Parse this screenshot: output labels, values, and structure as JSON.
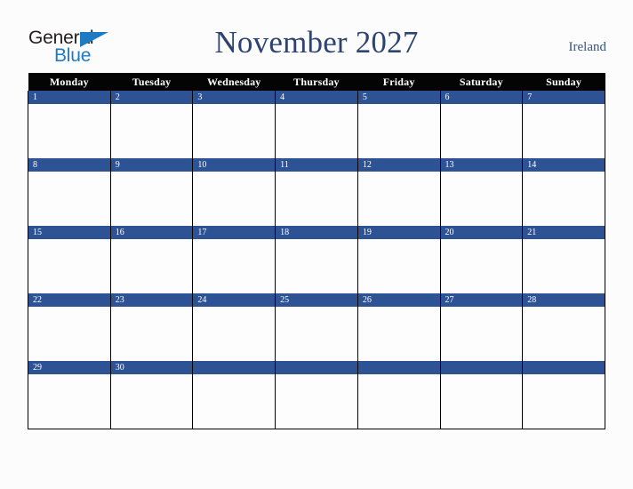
{
  "header": {
    "logo": {
      "word_one": "General",
      "word_two": "Blue",
      "triangle_icon": "blue-triangle-icon",
      "color_black": "#231f20",
      "color_blue": "#1f7ac4"
    },
    "title": "November 2027",
    "country": "Ireland",
    "title_color": "#2d4470"
  },
  "calendar": {
    "month": "November",
    "year": "2027",
    "weekday_headers": [
      "Monday",
      "Tuesday",
      "Wednesday",
      "Thursday",
      "Friday",
      "Saturday",
      "Sunday"
    ],
    "header_bg": "#040404",
    "header_fg": "#ffffff",
    "daynum_bg": "#2e5395",
    "daynum_fg": "#ffffff",
    "cell_bg": "#fdfdfd",
    "grid_line": "#000000",
    "weeks": [
      {
        "days": [
          "1",
          "2",
          "3",
          "4",
          "5",
          "6",
          "7"
        ]
      },
      {
        "days": [
          "8",
          "9",
          "10",
          "11",
          "12",
          "13",
          "14"
        ]
      },
      {
        "days": [
          "15",
          "16",
          "17",
          "18",
          "19",
          "20",
          "21"
        ]
      },
      {
        "days": [
          "22",
          "23",
          "24",
          "25",
          "26",
          "27",
          "28"
        ]
      },
      {
        "days": [
          "29",
          "30",
          "",
          "",
          "",
          "",
          ""
        ]
      }
    ]
  }
}
